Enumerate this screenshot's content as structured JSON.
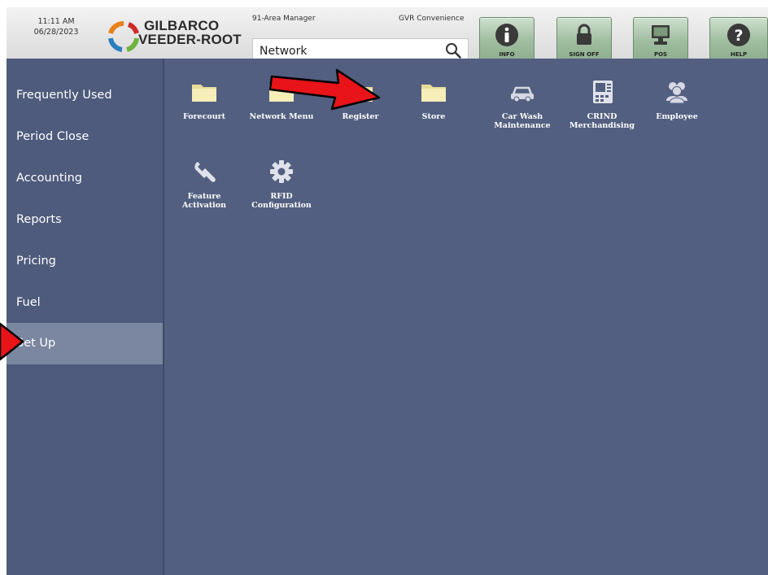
{
  "header": {
    "time": "11:11 AM",
    "date": "06/28/2023",
    "logo_line1": "GILBARCO",
    "logo_line2": "VEEDER-ROOT",
    "user_role": "91-Area Manager",
    "store_name": "GVR Convenience",
    "search": {
      "value": "Network",
      "placeholder": ""
    },
    "buttons": [
      {
        "label": "INFO",
        "icon": "info-icon"
      },
      {
        "label": "SIGN OFF",
        "icon": "lock-icon"
      },
      {
        "label": "POS",
        "icon": "monitor-icon"
      },
      {
        "label": "HELP",
        "icon": "help-icon"
      }
    ]
  },
  "sidebar": {
    "items": [
      {
        "label": "Frequently Used"
      },
      {
        "label": "Period Close"
      },
      {
        "label": "Accounting"
      },
      {
        "label": "Reports"
      },
      {
        "label": "Pricing"
      },
      {
        "label": "Fuel"
      },
      {
        "label": "Set Up",
        "active": true
      }
    ]
  },
  "main": {
    "tiles": [
      {
        "label": "Forecourt",
        "icon": "folder-icon"
      },
      {
        "label": "Network Menu",
        "icon": "folder-icon"
      },
      {
        "label": "Register",
        "icon": "folder-icon"
      },
      {
        "label": "Store",
        "icon": "folder-icon"
      },
      {
        "label": "Car Wash Maintenance",
        "icon": "car-icon"
      },
      {
        "label": "CRIND Merchandising",
        "icon": "crind-terminal-icon"
      },
      {
        "label": "Employee",
        "icon": "people-icon"
      },
      {
        "label": "Feature Activation",
        "icon": "wrench-icon"
      },
      {
        "label": "RFID Configuration",
        "icon": "gear-icon"
      }
    ]
  },
  "colors": {
    "sidebar_bg": "#4e5b7c",
    "sidebar_active": "#7b86a1",
    "main_bg": "#525f80",
    "button_green": "#9fbd9f",
    "folder_yellow": "#f3e9b0",
    "annotation_arrow": "#e8141a"
  }
}
